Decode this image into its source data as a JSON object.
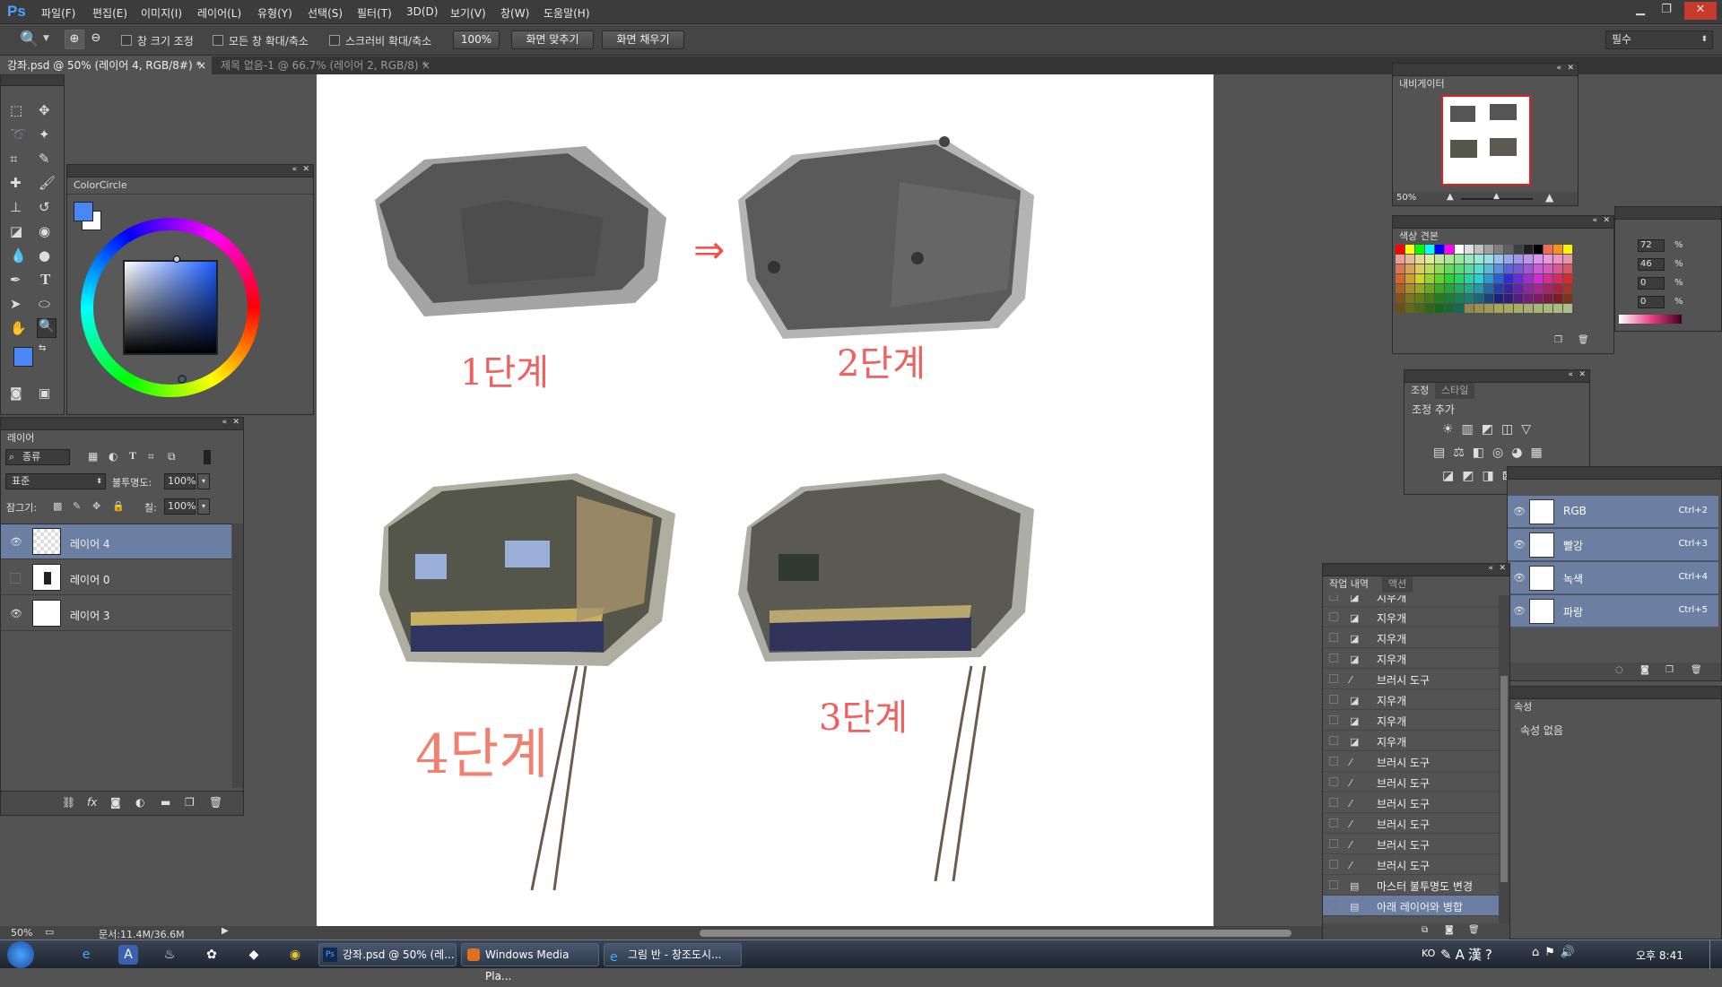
{
  "app": {
    "logo": "Ps"
  },
  "menu": [
    "파일(F)",
    "편집(E)",
    "이미지(I)",
    "레이어(L)",
    "유형(Y)",
    "선택(S)",
    "필터(T)",
    "3D(D)",
    "보기(V)",
    "창(W)",
    "도움말(H)"
  ],
  "options": {
    "resize_windows": "창 크기 조정",
    "zoom_all": "모든 창 확대/축소",
    "scrubby_zoom": "스크러비 확대/축소",
    "zoom_value": "100%",
    "fit_screen": "화면 맞추기",
    "fill_screen": "화면 채우기",
    "workspace": "필수"
  },
  "doc_tabs": [
    {
      "label": "강좌.psd @ 50% (레이어 4, RGB/8#) *",
      "active": true
    },
    {
      "label": "제목 없음-1 @ 66.7% (레이어 2, RGB/8) *",
      "active": false
    }
  ],
  "colorcircle": {
    "title": "ColorCircle",
    "fg": "#4a86f5",
    "bg": "#ffffff"
  },
  "layers": {
    "title": "레이어",
    "kind": "종류",
    "blend": "표준",
    "opacity_label": "불투명도:",
    "opacity": "100%",
    "lock_label": "잠그기:",
    "fill_label": "칠:",
    "fill": "100%",
    "items": [
      {
        "name": "레이어 4",
        "visible": true,
        "selected": true
      },
      {
        "name": "레이어 0",
        "visible": false,
        "selected": false
      },
      {
        "name": "레이어 3",
        "visible": true,
        "selected": false
      }
    ]
  },
  "navigator": {
    "title": "내비게이터",
    "zoom": "50%"
  },
  "swatches": {
    "title": "색상 견본"
  },
  "color_values": [
    "72",
    "46",
    "0",
    "0"
  ],
  "color_unit": "%",
  "adjustments": {
    "tab1": "조정",
    "tab2": "스타일",
    "add_label": "조정 추가"
  },
  "channels": [
    {
      "name": "RGB",
      "shortcut": "Ctrl+2"
    },
    {
      "name": "빨강",
      "shortcut": "Ctrl+3"
    },
    {
      "name": "녹색",
      "shortcut": "Ctrl+4"
    },
    {
      "name": "파랑",
      "shortcut": "Ctrl+5"
    }
  ],
  "properties": {
    "title": "속성",
    "empty": "속성 없음"
  },
  "history": {
    "tab1": "작업 내역",
    "tab2": "액션",
    "items": [
      {
        "label": "지우개",
        "icon": "eraser"
      },
      {
        "label": "지우개",
        "icon": "eraser"
      },
      {
        "label": "지우개",
        "icon": "eraser"
      },
      {
        "label": "지우개",
        "icon": "eraser"
      },
      {
        "label": "브러시 도구",
        "icon": "brush"
      },
      {
        "label": "지우개",
        "icon": "eraser"
      },
      {
        "label": "지우개",
        "icon": "eraser"
      },
      {
        "label": "지우개",
        "icon": "eraser"
      },
      {
        "label": "브러시 도구",
        "icon": "brush"
      },
      {
        "label": "브러시 도구",
        "icon": "brush"
      },
      {
        "label": "브러시 도구",
        "icon": "brush"
      },
      {
        "label": "브러시 도구",
        "icon": "brush"
      },
      {
        "label": "브러시 도구",
        "icon": "brush"
      },
      {
        "label": "브러시 도구",
        "icon": "brush"
      },
      {
        "label": "마스터 불투명도 변경",
        "icon": "doc"
      },
      {
        "label": "아래 레이어와 병합",
        "icon": "doc",
        "selected": true
      }
    ]
  },
  "status": {
    "zoom": "50%",
    "doc": "문서:11.4M/36.6M"
  },
  "canvas": {
    "stage1": "1단계",
    "stage2": "2단계",
    "stage3": "3단계",
    "stage4": "4단계",
    "arrow": "⇒"
  },
  "taskbar": {
    "tasks": [
      "강좌.psd @ 50% (레...",
      "Windows Media Pla...",
      "그림 반 - 창조도시..."
    ],
    "lang": "KO",
    "time": "오후 8:41"
  }
}
